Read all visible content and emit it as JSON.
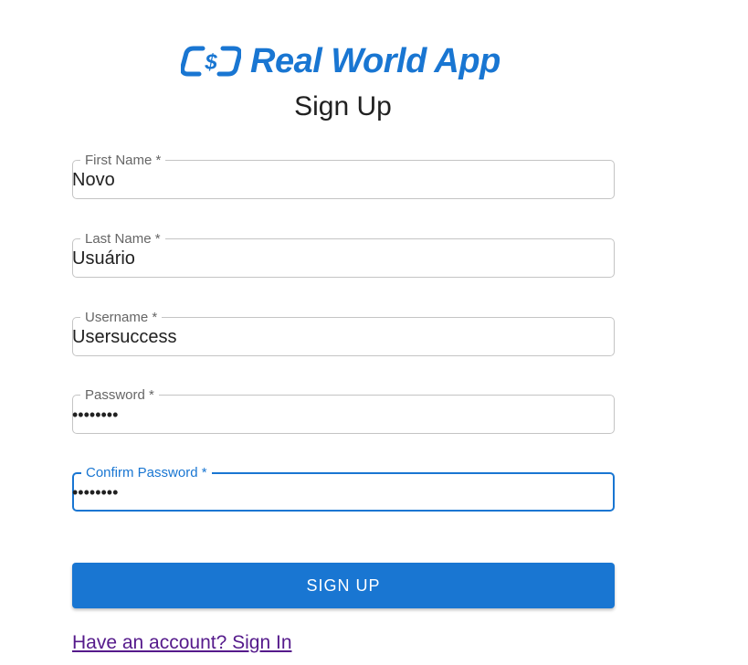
{
  "brand": {
    "name": "Real World App",
    "logo_icon": "currency-exchange-icon",
    "accent_color": "#1976d2"
  },
  "page": {
    "title": "Sign Up"
  },
  "form": {
    "first_name": {
      "label": "First Name *",
      "value": "Novo"
    },
    "last_name": {
      "label": "Last Name *",
      "value": "Usuário"
    },
    "username": {
      "label": "Username *",
      "value": "Usersuccess"
    },
    "password": {
      "label": "Password *",
      "value": "••••••••"
    },
    "confirm_password": {
      "label": "Confirm Password *",
      "value": "••••••••",
      "focused": true
    },
    "submit_label": "SIGN UP",
    "signin_link": "Have an account? Sign In"
  }
}
